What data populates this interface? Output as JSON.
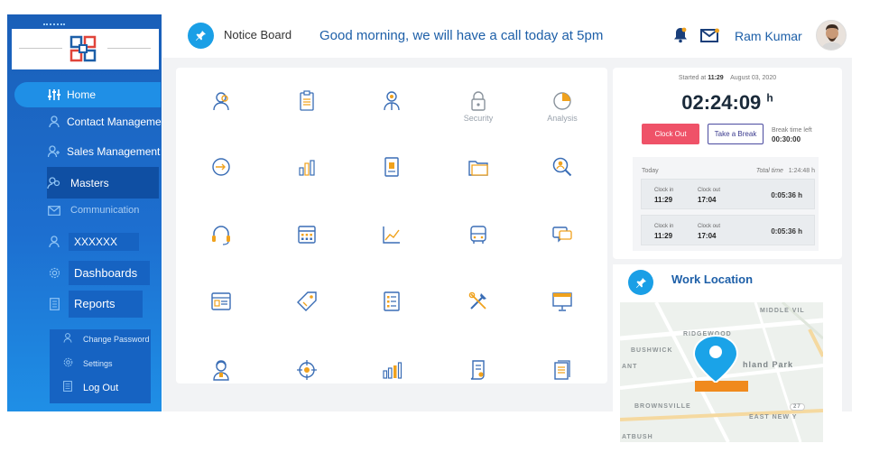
{
  "header": {
    "notice_board": "Notice Board",
    "message": "Good morning, we will have a call today at 5pm",
    "user_name": "Ram Kumar"
  },
  "sidebar": {
    "items": [
      {
        "label": "Home",
        "icon": "sliders-icon"
      },
      {
        "label": "Contact Management",
        "icon": "user-icon"
      },
      {
        "label": "Sales Management",
        "icon": "user-plus-icon"
      },
      {
        "label": "Masters",
        "icon": "users-icon"
      },
      {
        "label": "Communication",
        "icon": "mail-icon"
      },
      {
        "label": "XXXXXX",
        "icon": "user-icon"
      },
      {
        "label": "Dashboards",
        "icon": "gear-icon"
      },
      {
        "label": "Reports",
        "icon": "document-icon"
      }
    ],
    "sub_items": [
      {
        "label": "Change Password",
        "icon": "user-icon"
      },
      {
        "label": "Settings",
        "icon": "gear-icon"
      },
      {
        "label": "Log Out",
        "icon": "document-icon"
      }
    ]
  },
  "tiles": {
    "security": "Security",
    "analysis": "Analysis"
  },
  "clock": {
    "started_prefix": "Started at",
    "started_time": "11:29",
    "date": "August 03, 2020",
    "timer": "02:24:09",
    "timer_unit": "h",
    "clock_out": "Clock Out",
    "take_break": "Take a Break",
    "break_left_label": "Break time left",
    "break_left_value": "00:30:00",
    "today": "Today",
    "total_label": "Total time",
    "total_value": "1:24:48 h",
    "entries": [
      {
        "clock_in_label": "Clock in",
        "clock_in": "11:29",
        "clock_out_label": "Clock out",
        "clock_out": "17:04",
        "duration": "0:05:36 h"
      },
      {
        "clock_in_label": "Clock in",
        "clock_in": "11:29",
        "clock_out_label": "Clock out",
        "clock_out": "17:04",
        "duration": "0:05:36 h"
      }
    ]
  },
  "location": {
    "title": "Work Location",
    "map_labels": [
      "MIDDLE VIL",
      "RIDGEWOOD",
      "BUSHWICK",
      "hland Park",
      "ANT",
      "BROWNSVILLE",
      "EAST NEW Y",
      "ATBUSH",
      "27"
    ]
  },
  "colors": {
    "sidebar": "#1d6fd0",
    "accent": "#1a9fe6",
    "clock_out": "#ef5268",
    "brand_text": "#1d5fa8",
    "map_pin": "#1aa3e8",
    "map_base": "#f08a1d"
  }
}
